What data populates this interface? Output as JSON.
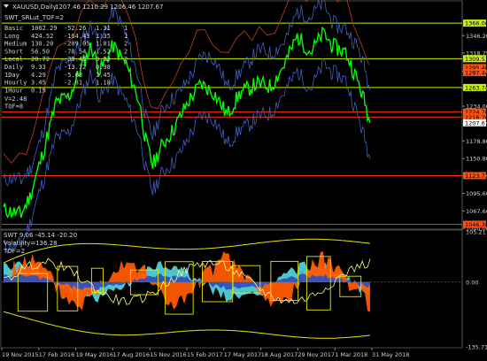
{
  "window": {
    "title": "XAUUSD,Daily",
    "ohlc": "1207.46 1210.29 1206.46 1207.67",
    "indicator_title": "SWT_SRLut_TOF=2",
    "osc_title": "SWT 9.06 -45.14 -20.20",
    "osc_volatility": "Volatility=136.28",
    "osc_tof": "TOF=2"
  },
  "stats_table": [
    [
      "Basic",
      "1062.29",
      "-52.26",
      "1.31",
      "1"
    ],
    [
      "Long",
      "424.52",
      "-164.43",
      "1.35",
      "1"
    ],
    [
      "Medium",
      "130.20",
      "-209.05",
      "1.01",
      "2"
    ],
    [
      "Short",
      "56.50",
      "-78.54",
      "1.52",
      "2"
    ],
    [
      "Local",
      "20.72",
      "-38.45",
      "0.93",
      "2"
    ],
    [
      "Daily",
      "9.33",
      "-13.72",
      "0.98",
      ""
    ],
    [
      "1Day",
      "4.29",
      "-5.68",
      "1.45",
      ""
    ],
    [
      "Hourly",
      "3.45",
      "-2.81",
      "1.18",
      ""
    ],
    [
      "1Hour",
      "0.19",
      "",
      "",
      ""
    ]
  ],
  "extra_lines": [
    "V=2.48",
    "TOF=8"
  ],
  "price_axis": {
    "ticks": [
      "1346.20",
      "1318.75",
      "1289.70",
      "1262.00",
      "1234.00",
      "1206.25",
      "1178.80",
      "1150.80",
      "1123.00",
      "1095.60",
      "1067.60",
      "1040.00"
    ],
    "tags": [
      {
        "value": "1366.08",
        "color": "#c8f000"
      },
      {
        "value": "1309.53",
        "color": "#c8f000"
      },
      {
        "value": "1295.40",
        "color": "#ff5010"
      },
      {
        "value": "1287.44",
        "color": "#ff5010"
      },
      {
        "value": "1263.74",
        "color": "#c8f000"
      },
      {
        "value": "1224.76",
        "color": "#ff5010"
      },
      {
        "value": "1216.76",
        "color": "#ff5010"
      },
      {
        "value": "1207.67",
        "color": "#ffffff"
      },
      {
        "value": "1123.72",
        "color": "#ff5010"
      },
      {
        "value": "1046.38",
        "color": "#ff5010"
      }
    ]
  },
  "osc_axis": {
    "ticks": [
      "105.21",
      "0.00",
      "-135.71"
    ]
  },
  "time_axis": [
    "19 Nov 2015",
    "17 Feb 2016",
    "19 May 2016",
    "17 Aug 2016",
    "15 Nov 2016",
    "15 Feb 2017",
    "17 May 2017",
    "18 Aug 2017",
    "29 Nov 2017",
    "1 Mar 2018",
    "31 May 2018"
  ],
  "colors": {
    "background": "#000000",
    "price_line": "#00ff00",
    "level_yellow": "#c8f000",
    "level_red": "#ff3010",
    "osc_orange": "#ff5a00",
    "osc_cyan": "#50d0d8",
    "osc_blue": "#3050c0",
    "osc_yellow": "#e8e800",
    "blue_band": "#4060c0"
  }
}
